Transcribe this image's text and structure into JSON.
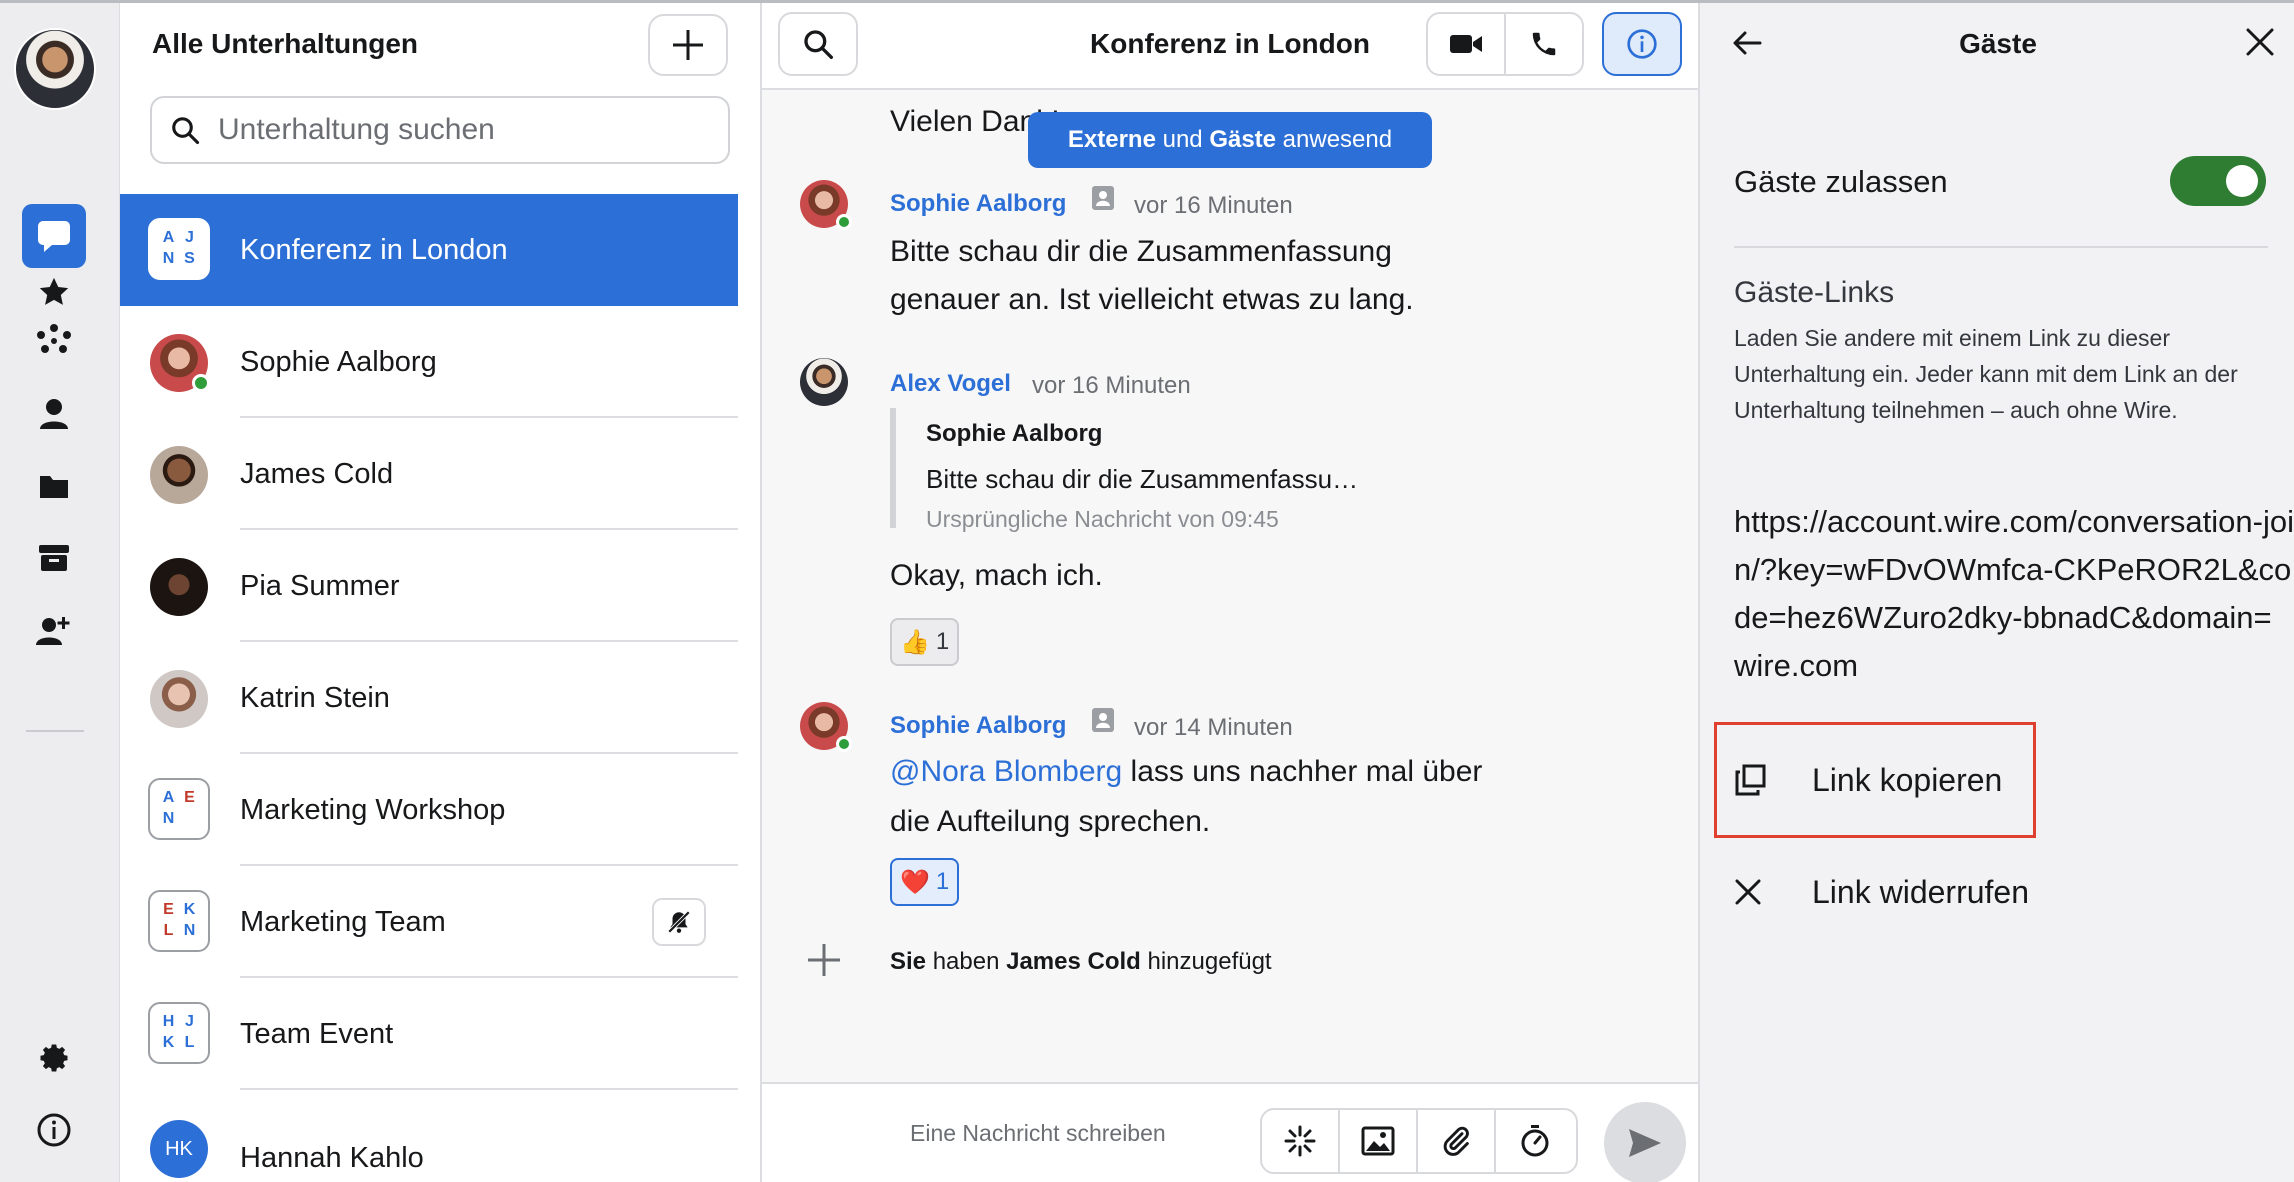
{
  "sidebar": {
    "items": [
      {
        "icon": "chat-bubble-icon",
        "active": true
      },
      {
        "icon": "star-icon"
      },
      {
        "icon": "people-dots-icon"
      },
      {
        "icon": "person-icon"
      },
      {
        "icon": "folder-icon"
      },
      {
        "icon": "archive-icon"
      },
      {
        "icon": "add-person-icon"
      }
    ],
    "bottom": [
      {
        "icon": "gear-icon"
      },
      {
        "icon": "info-icon"
      }
    ]
  },
  "list": {
    "title": "Alle Unterhaltungen",
    "search_placeholder": "Unterhaltung suchen",
    "conversations": [
      {
        "name": "Konferenz in London",
        "type": "group",
        "initials": [
          "A",
          "J",
          "N",
          "S"
        ]
      },
      {
        "name": "Sophie Aalborg",
        "type": "person",
        "online": true
      },
      {
        "name": "James Cold",
        "type": "person"
      },
      {
        "name": "Pia Summer",
        "type": "person"
      },
      {
        "name": "Katrin Stein",
        "type": "person"
      },
      {
        "name": "Marketing Workshop",
        "type": "group",
        "initials": [
          "A",
          "E",
          "N",
          ""
        ]
      },
      {
        "name": "Marketing Team",
        "type": "group",
        "initials": [
          "E",
          "K",
          "L",
          "N"
        ],
        "muted": true
      },
      {
        "name": "Team Event",
        "type": "group",
        "initials": [
          "H",
          "J",
          "K",
          "L"
        ]
      },
      {
        "name": "Hannah Kahlo",
        "type": "initials",
        "initials_text": "HK"
      }
    ]
  },
  "chat": {
    "title": "Konferenz in London",
    "tooltip": {
      "part1": "Externe",
      "part2": " und ",
      "part3": "Gäste",
      "part4": " anwesend"
    },
    "partial_message": "Vielen Dank!",
    "messages": [
      {
        "sender": "Sophie Aalborg",
        "time": "vor 16 Minuten",
        "line1": "Bitte schau dir die Zusammenfassung",
        "line2": "genauer an. Ist vielleicht etwas zu lang."
      },
      {
        "sender": "Alex Vogel",
        "time": "vor 16 Minuten",
        "quote_sender": "Sophie Aalborg",
        "quote_text": "Bitte schau dir die Zusammenfassu…",
        "quote_meta": "Ursprüngliche Nachricht von 09:45",
        "text": "Okay, mach ich.",
        "reaction_emoji": "👍",
        "reaction_count": "1"
      },
      {
        "sender": "Sophie Aalborg",
        "time": "vor 14 Minuten",
        "mention": "@Nora Blomberg",
        "line1_rest": " lass uns nachher mal über",
        "line2": "die Aufteilung sprechen.",
        "reaction_emoji": "❤️",
        "reaction_count": "1"
      }
    ],
    "system": {
      "who": "Sie",
      "verb": " haben ",
      "target": "James Cold",
      "action": " hinzugefügt"
    },
    "composer_placeholder": "Eine Nachricht schreiben"
  },
  "panel": {
    "title": "Gäste",
    "toggle_label": "Gäste zulassen",
    "toggle_on": true,
    "links_title": "Gäste-Links",
    "links_desc": "Laden Sie andere mit einem Link zu dieser Unterhaltung ein. Jeder kann mit dem Link an der Unterhaltung teilnehmen – auch ohne Wire.",
    "link_url": "https://account.wire.com/conversation-join/?key=wFDvOWmfca-CKPeROR2L&code=hez6WZuro2dky-bbnadC&domain=wire.com",
    "copy_label": "Link kopieren",
    "revoke_label": "Link widerrufen"
  },
  "colors": {
    "accent": "#2c6fd6",
    "online": "#2f9e3a",
    "toggle": "#2f7d32",
    "highlight": "#e0402f"
  }
}
